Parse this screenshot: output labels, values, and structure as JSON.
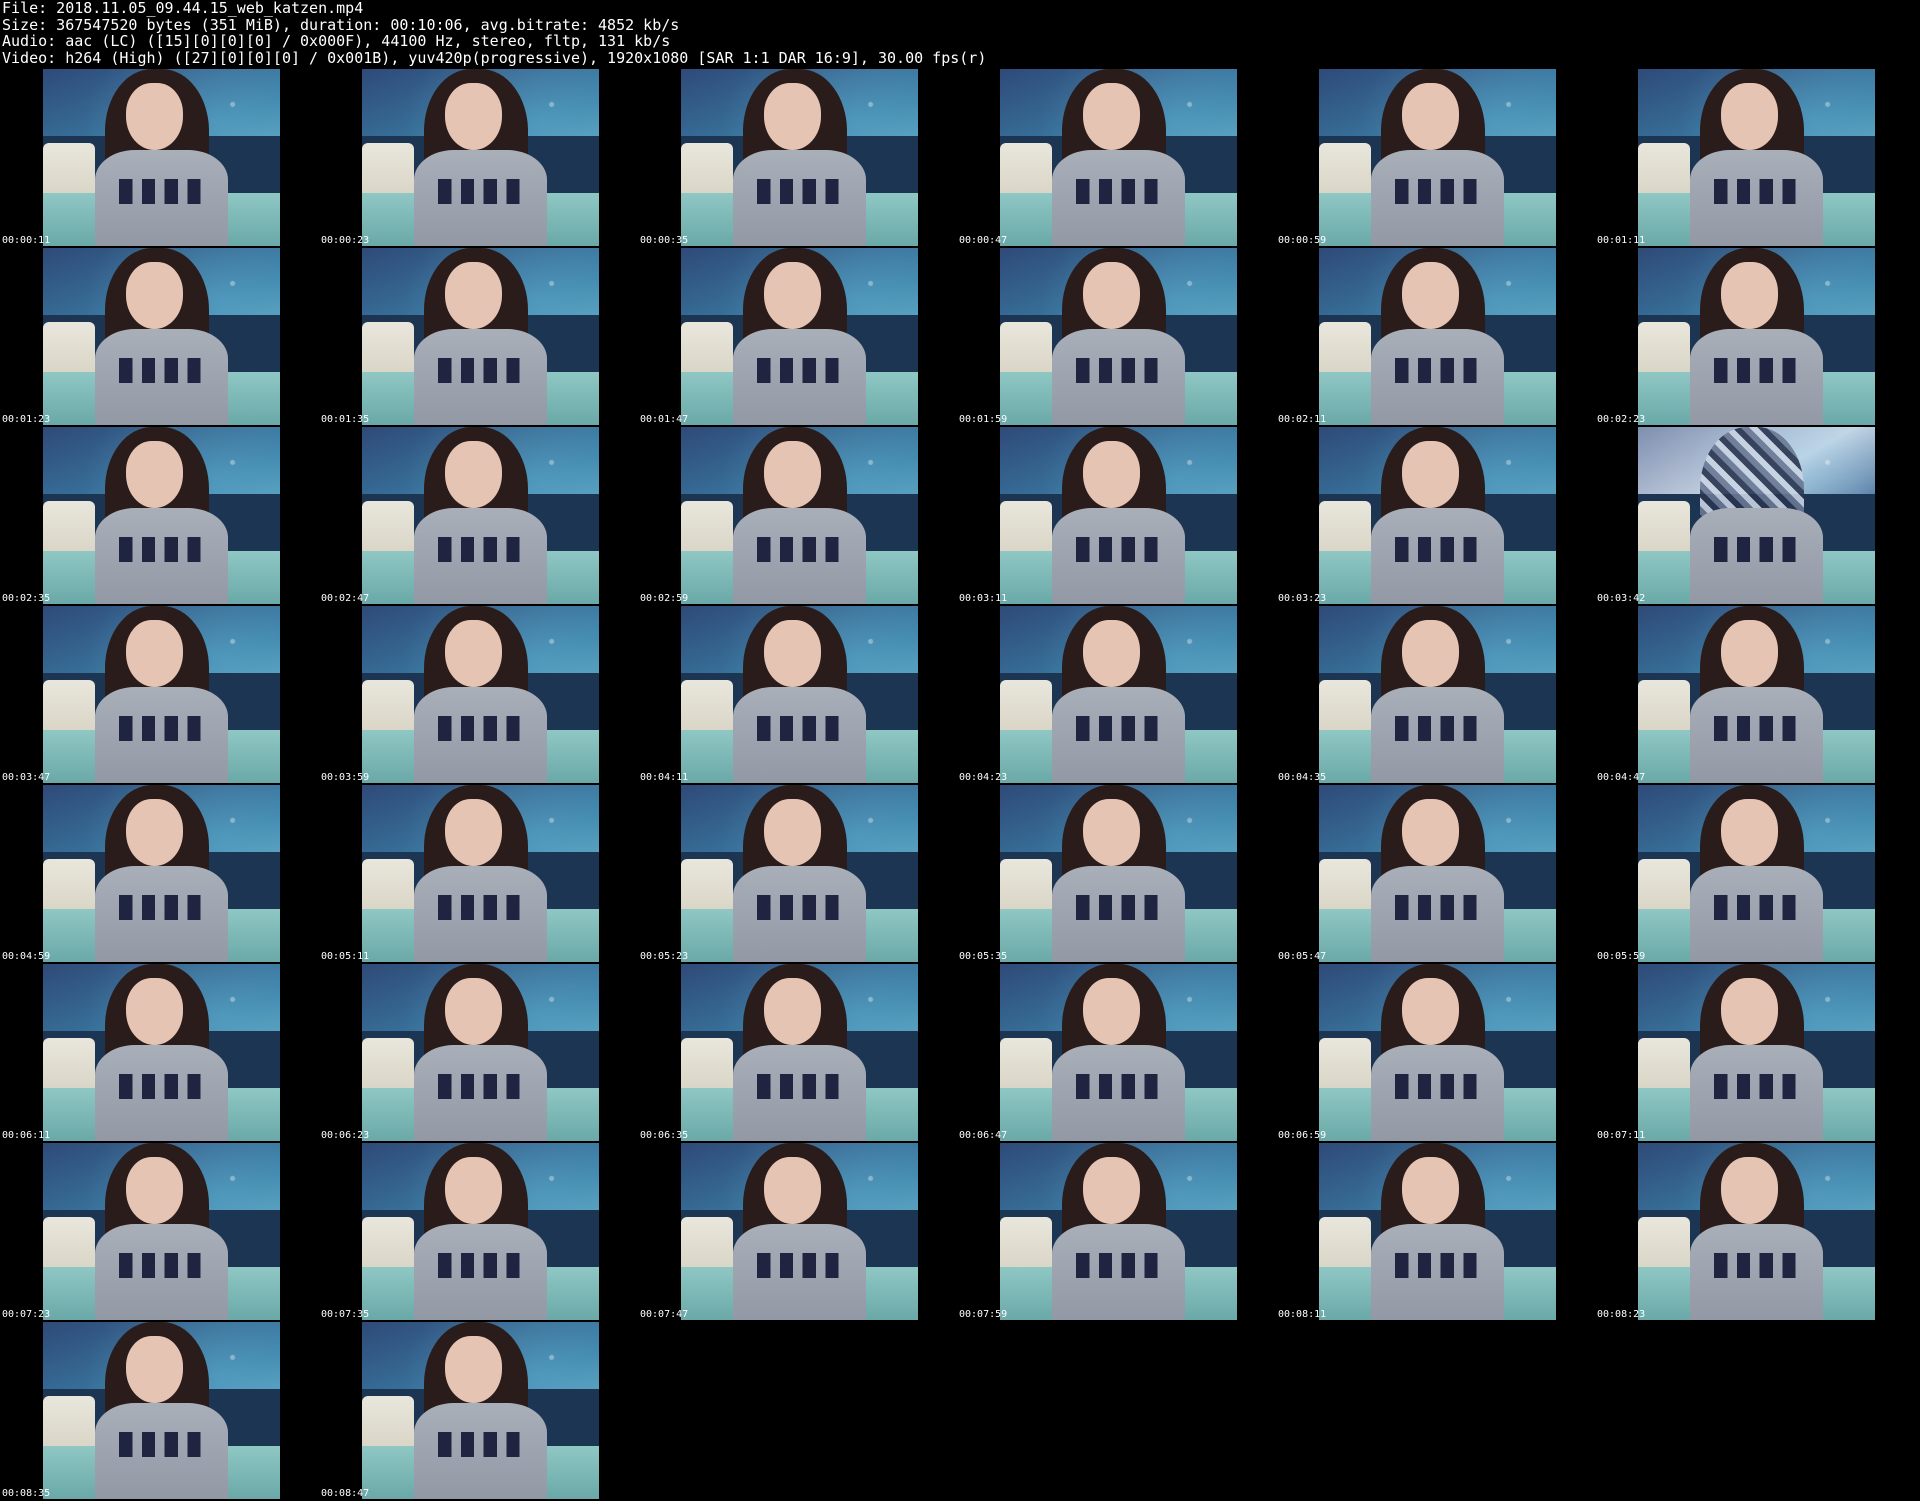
{
  "header": {
    "file_line": "File: 2018.11.05_09.44.15_web_katzen.mp4",
    "size_line": "Size: 367547520 bytes (351 MiB), duration: 00:10:06, avg.bitrate: 4852 kb/s",
    "audio_line": "Audio: aac (LC) ([15][0][0][0] / 0x000F), 44100 Hz, stereo, fltp, 131 kb/s",
    "video_line": "Video: h264 (High) ([27][0][0][0] / 0x001B), yuv420p(progressive), 1920x1080 [SAR 1:1 DAR 16:9], 30.00 fps(r)"
  },
  "thumbnails": [
    {
      "time": "00:00:11"
    },
    {
      "time": "00:00:23"
    },
    {
      "time": "00:00:35"
    },
    {
      "time": "00:00:47"
    },
    {
      "time": "00:00:59"
    },
    {
      "time": "00:01:11"
    },
    {
      "time": "00:01:23"
    },
    {
      "time": "00:01:35"
    },
    {
      "time": "00:01:47"
    },
    {
      "time": "00:01:59"
    },
    {
      "time": "00:02:11"
    },
    {
      "time": "00:02:23"
    },
    {
      "time": "00:02:35"
    },
    {
      "time": "00:02:47"
    },
    {
      "time": "00:02:59"
    },
    {
      "time": "00:03:11"
    },
    {
      "time": "00:03:23"
    },
    {
      "time": "00:03:42"
    },
    {
      "time": "00:03:47"
    },
    {
      "time": "00:03:59"
    },
    {
      "time": "00:04:11"
    },
    {
      "time": "00:04:23"
    },
    {
      "time": "00:04:35"
    },
    {
      "time": "00:04:47"
    },
    {
      "time": "00:04:59"
    },
    {
      "time": "00:05:11"
    },
    {
      "time": "00:05:23"
    },
    {
      "time": "00:05:35"
    },
    {
      "time": "00:05:47"
    },
    {
      "time": "00:05:59"
    },
    {
      "time": "00:06:11"
    },
    {
      "time": "00:06:23"
    },
    {
      "time": "00:06:35"
    },
    {
      "time": "00:06:47"
    },
    {
      "time": "00:06:59"
    },
    {
      "time": "00:07:11"
    },
    {
      "time": "00:07:23"
    },
    {
      "time": "00:07:35"
    },
    {
      "time": "00:07:47"
    },
    {
      "time": "00:07:59"
    },
    {
      "time": "00:08:11"
    },
    {
      "time": "00:08:23"
    },
    {
      "time": "00:08:35"
    },
    {
      "time": "00:08:47"
    }
  ]
}
